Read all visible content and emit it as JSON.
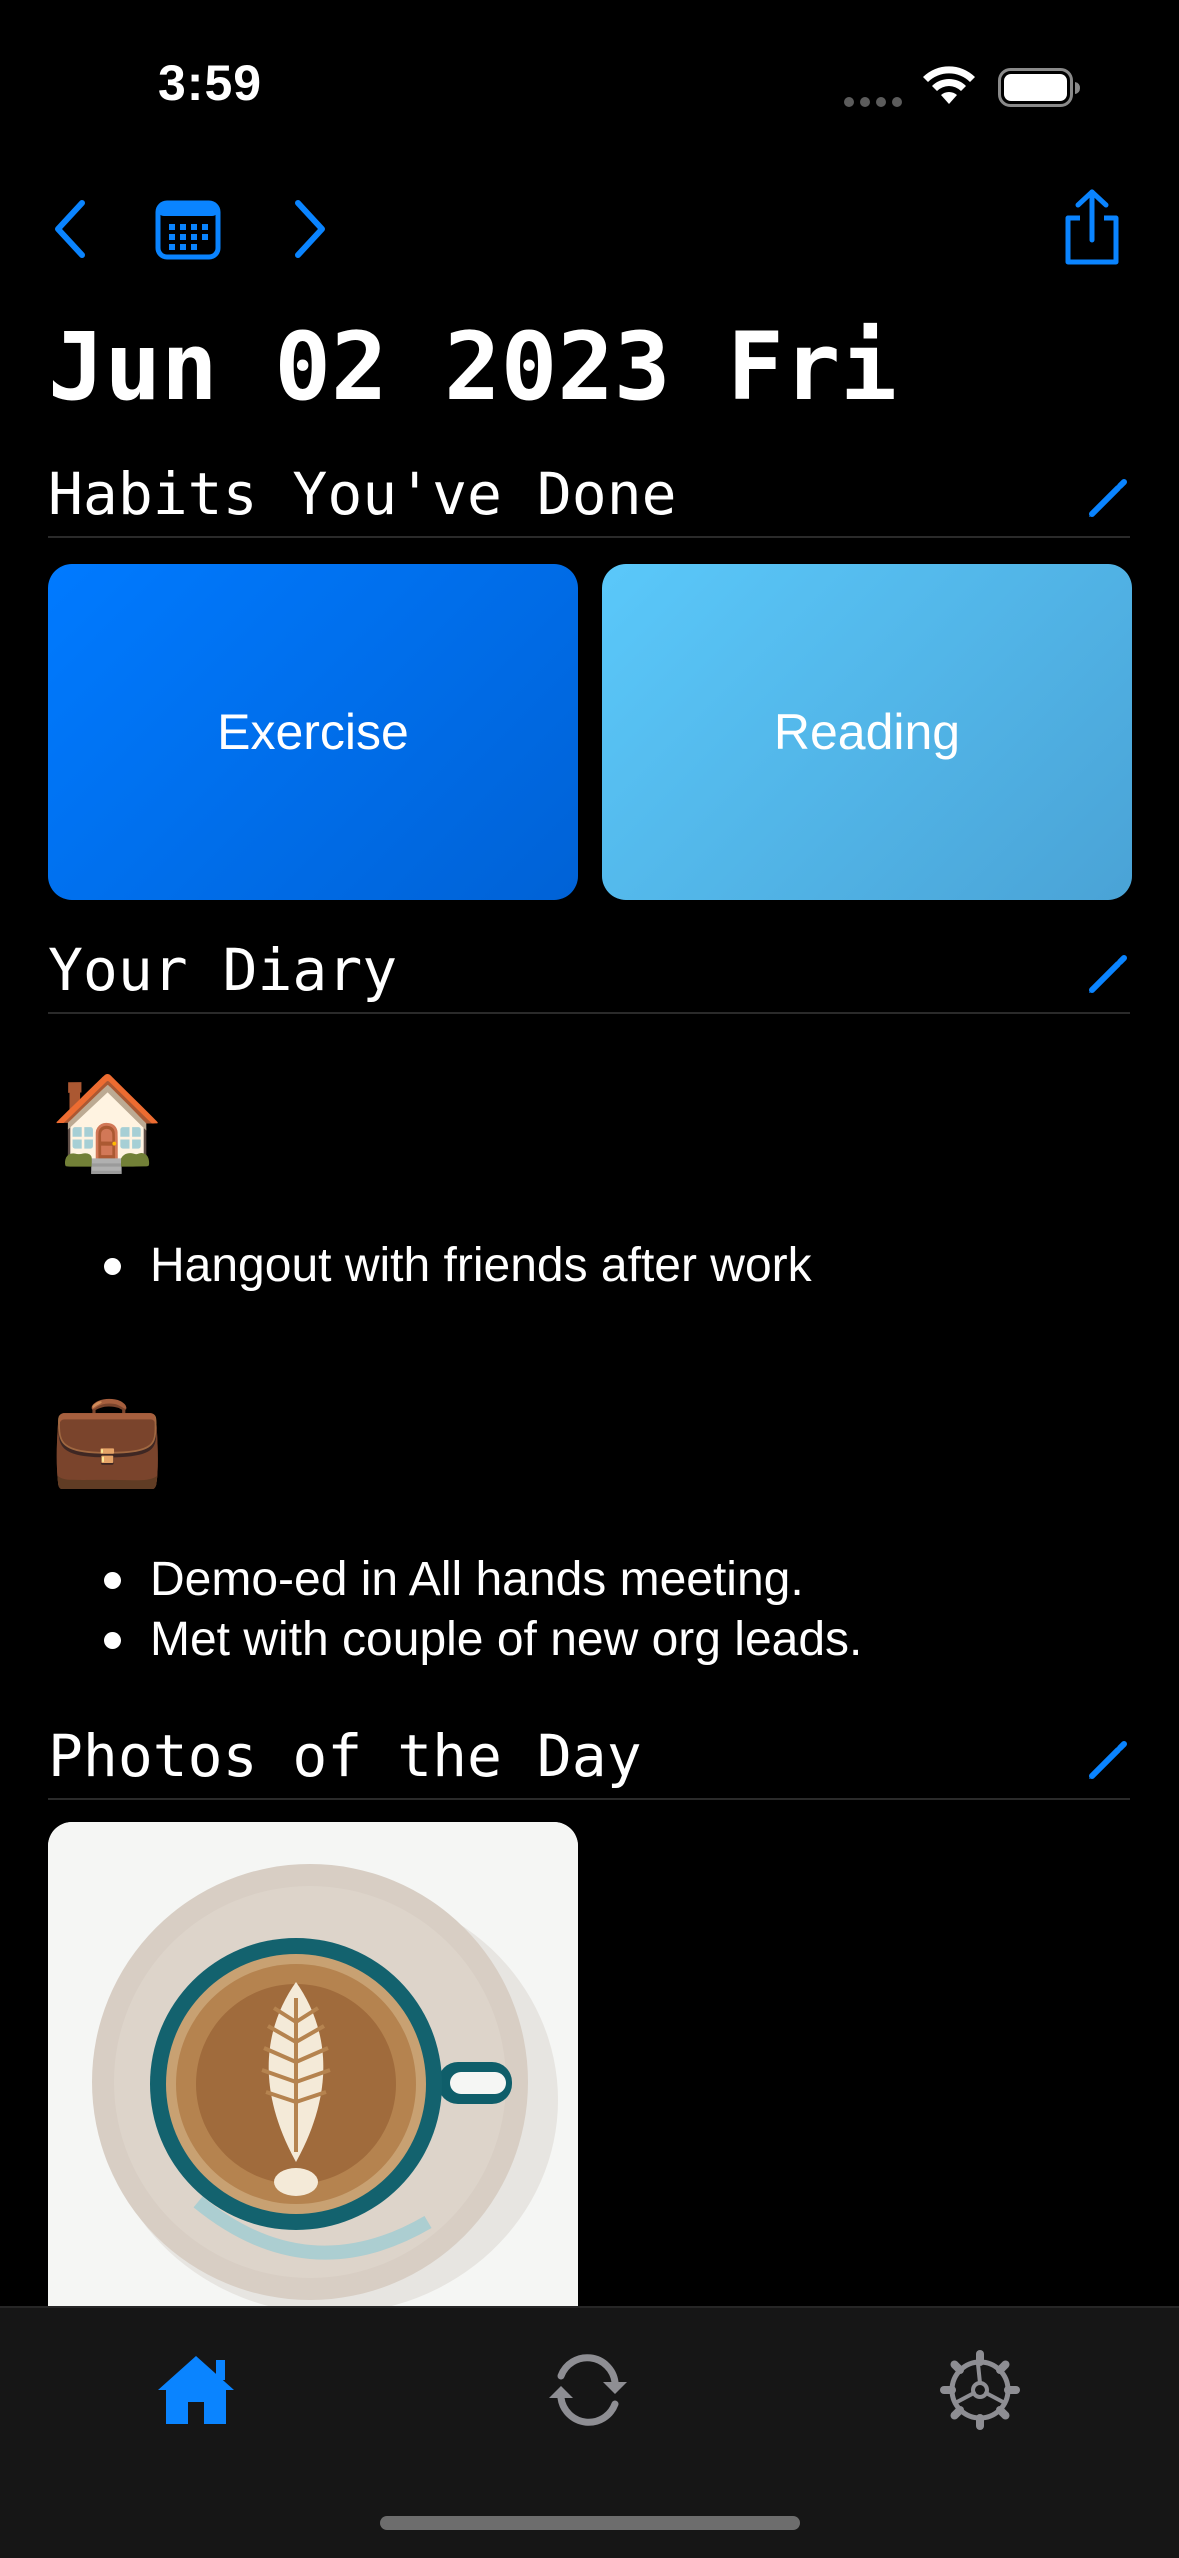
{
  "status_bar": {
    "time": "3:59"
  },
  "toolbar": {
    "back_icon": "chevron-left-icon",
    "calendar_icon": "calendar-icon",
    "forward_icon": "chevron-right-icon",
    "share_icon": "share-icon"
  },
  "date_title": "Jun 02 2023 Fri",
  "sections": {
    "habits": {
      "title": "Habits You've Done"
    },
    "diary": {
      "title": "Your Diary"
    },
    "photos": {
      "title": "Photos of the Day"
    }
  },
  "habits": [
    {
      "label": "Exercise",
      "color": "#007aff"
    },
    {
      "label": "Reading",
      "color": "#5ac8fa"
    }
  ],
  "diary": [
    {
      "emoji": "🏠",
      "items": [
        "Hangout with friends after work"
      ]
    },
    {
      "emoji": "💼",
      "items": [
        "Demo-ed in All hands meeting.",
        "Met with couple of new org leads."
      ]
    }
  ],
  "tab_bar": {
    "tabs": [
      {
        "name": "home",
        "icon": "house-icon",
        "active": true
      },
      {
        "name": "sync",
        "icon": "sync-icon",
        "active": false
      },
      {
        "name": "settings",
        "icon": "gear-icon",
        "active": false
      }
    ]
  },
  "colors": {
    "accent": "#0a84ff",
    "background": "#000000",
    "tab_inactive": "#8e8e93"
  }
}
